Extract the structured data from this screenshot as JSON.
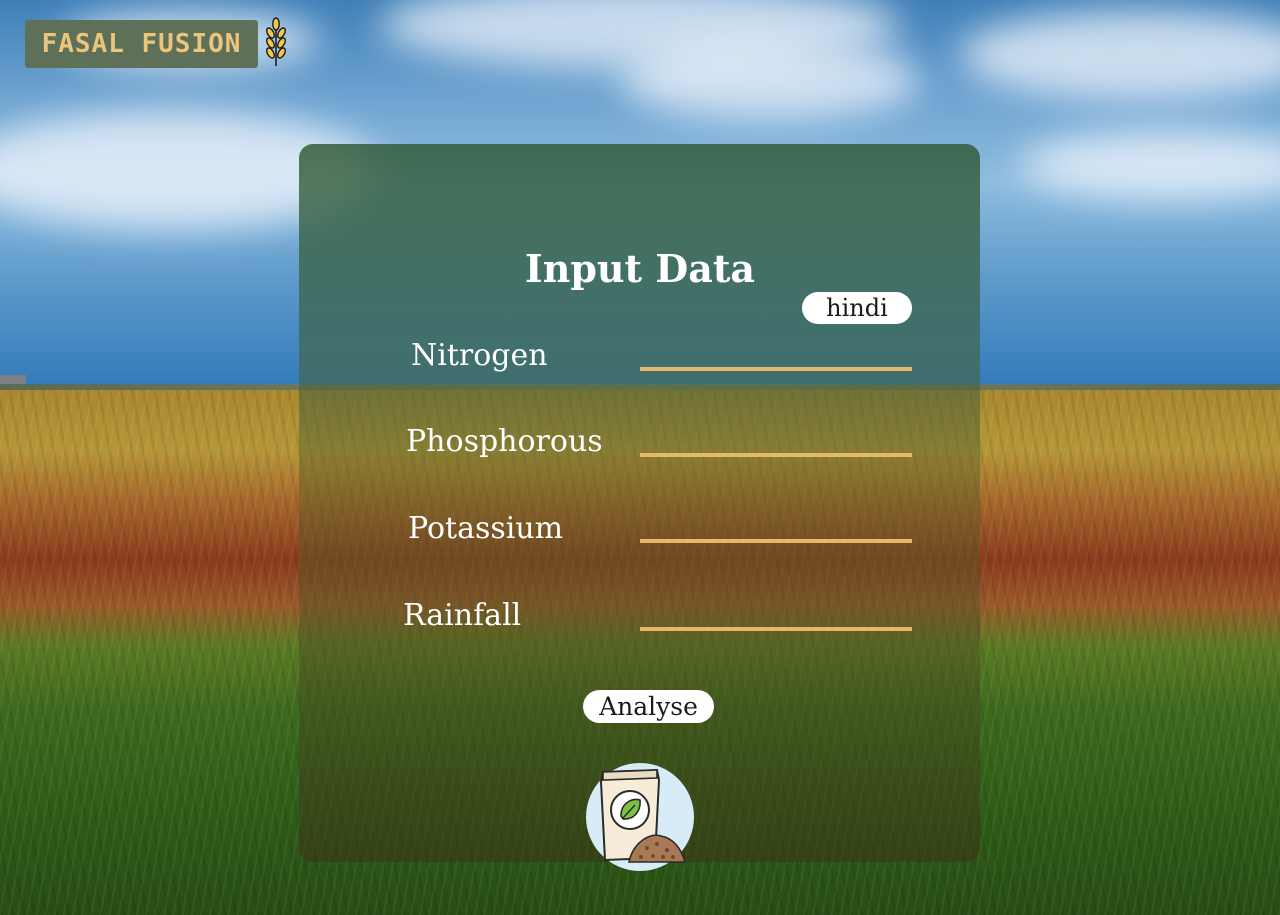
{
  "app": {
    "logo_text": "FASAL FUSION"
  },
  "form": {
    "title": "Input Data",
    "language_button": "hindi",
    "fields": [
      {
        "label": "Nitrogen",
        "value": "",
        "placeholder": ""
      },
      {
        "label": "Phosphorous",
        "value": "",
        "placeholder": ""
      },
      {
        "label": "Potassium",
        "value": "",
        "placeholder": ""
      },
      {
        "label": "Rainfall",
        "value": "",
        "placeholder": ""
      }
    ],
    "submit_button": "Analyse"
  },
  "icons": {
    "logo_icon": "wheat-icon",
    "form_icon": "fertilizer-bag-icon"
  },
  "colors": {
    "logo_bg": "#5e7158",
    "logo_text": "#ecc57c",
    "input_underline": "#e6b86e",
    "button_bg": "#ffffff"
  }
}
